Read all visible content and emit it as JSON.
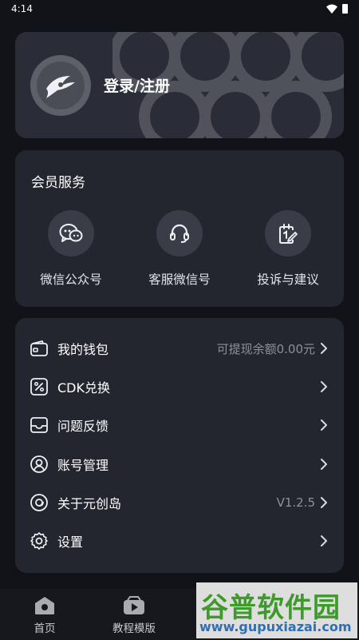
{
  "status_bar": {
    "time": "4:14"
  },
  "login": {
    "label": "登录/注册"
  },
  "services": {
    "title": "会员服务",
    "items": [
      {
        "label": "微信公众号",
        "icon": "wechat-icon"
      },
      {
        "label": "客服微信号",
        "icon": "headset-icon"
      },
      {
        "label": "投诉与建议",
        "icon": "feedback-edit-icon"
      }
    ]
  },
  "menu": {
    "items": [
      {
        "label": "我的钱包",
        "value": "可提现余额0.00元",
        "icon": "wallet-icon"
      },
      {
        "label": "CDK兑换",
        "value": "",
        "icon": "percent-coupon-icon"
      },
      {
        "label": "问题反馈",
        "value": "",
        "icon": "inbox-icon"
      },
      {
        "label": "账号管理",
        "value": "",
        "icon": "user-circle-icon"
      },
      {
        "label": "关于元创岛",
        "value": "V1.2.5",
        "icon": "info-disc-icon"
      },
      {
        "label": "设置",
        "value": "",
        "icon": "gear-icon"
      }
    ]
  },
  "bottom_nav": {
    "items": [
      {
        "label": "首页",
        "icon": "home-icon"
      },
      {
        "label": "教程模版",
        "icon": "play-template-icon"
      }
    ]
  },
  "watermark": {
    "title": "谷普软件园",
    "url": "www.gupuxiazai.com"
  }
}
